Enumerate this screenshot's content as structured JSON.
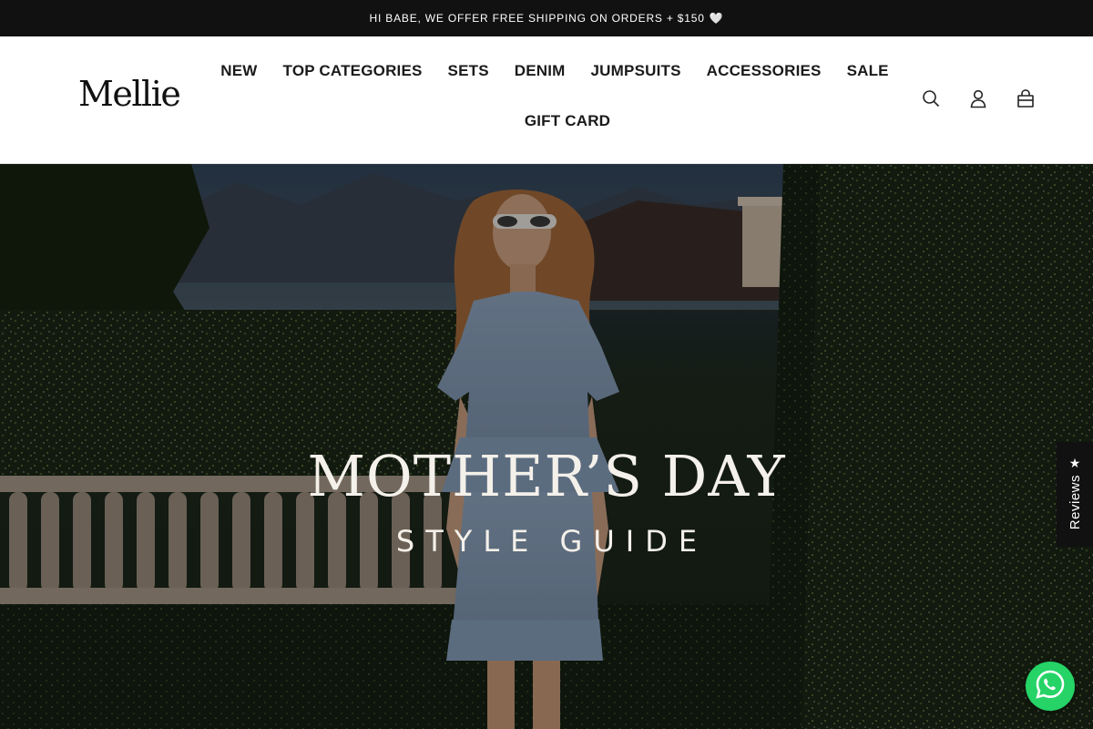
{
  "announcement": {
    "text": "HI BABE, WE OFFER FREE SHIPPING ON ORDERS + $150",
    "emoji": "🤍"
  },
  "header": {
    "logo": "Mellie",
    "nav": [
      {
        "label": "NEW"
      },
      {
        "label": "TOP CATEGORIES"
      },
      {
        "label": "SETS"
      },
      {
        "label": "DENIM"
      },
      {
        "label": "JUMPSUITS"
      },
      {
        "label": "ACCESSORIES"
      },
      {
        "label": "SALE"
      },
      {
        "label": "GIFT CARD"
      }
    ],
    "icons": [
      "search-icon",
      "account-icon",
      "cart-icon"
    ]
  },
  "hero": {
    "title": "MOTHER’S DAY",
    "subtitle": "STYLE GUIDE"
  },
  "reviews_tab": {
    "label": "Reviews",
    "icon": "star-icon"
  },
  "whatsapp": {
    "icon": "whatsapp-icon",
    "color": "#25d366"
  },
  "colors": {
    "announcement_bg": "#111111",
    "text": "#1a1a1a",
    "whatsapp": "#25d366"
  }
}
